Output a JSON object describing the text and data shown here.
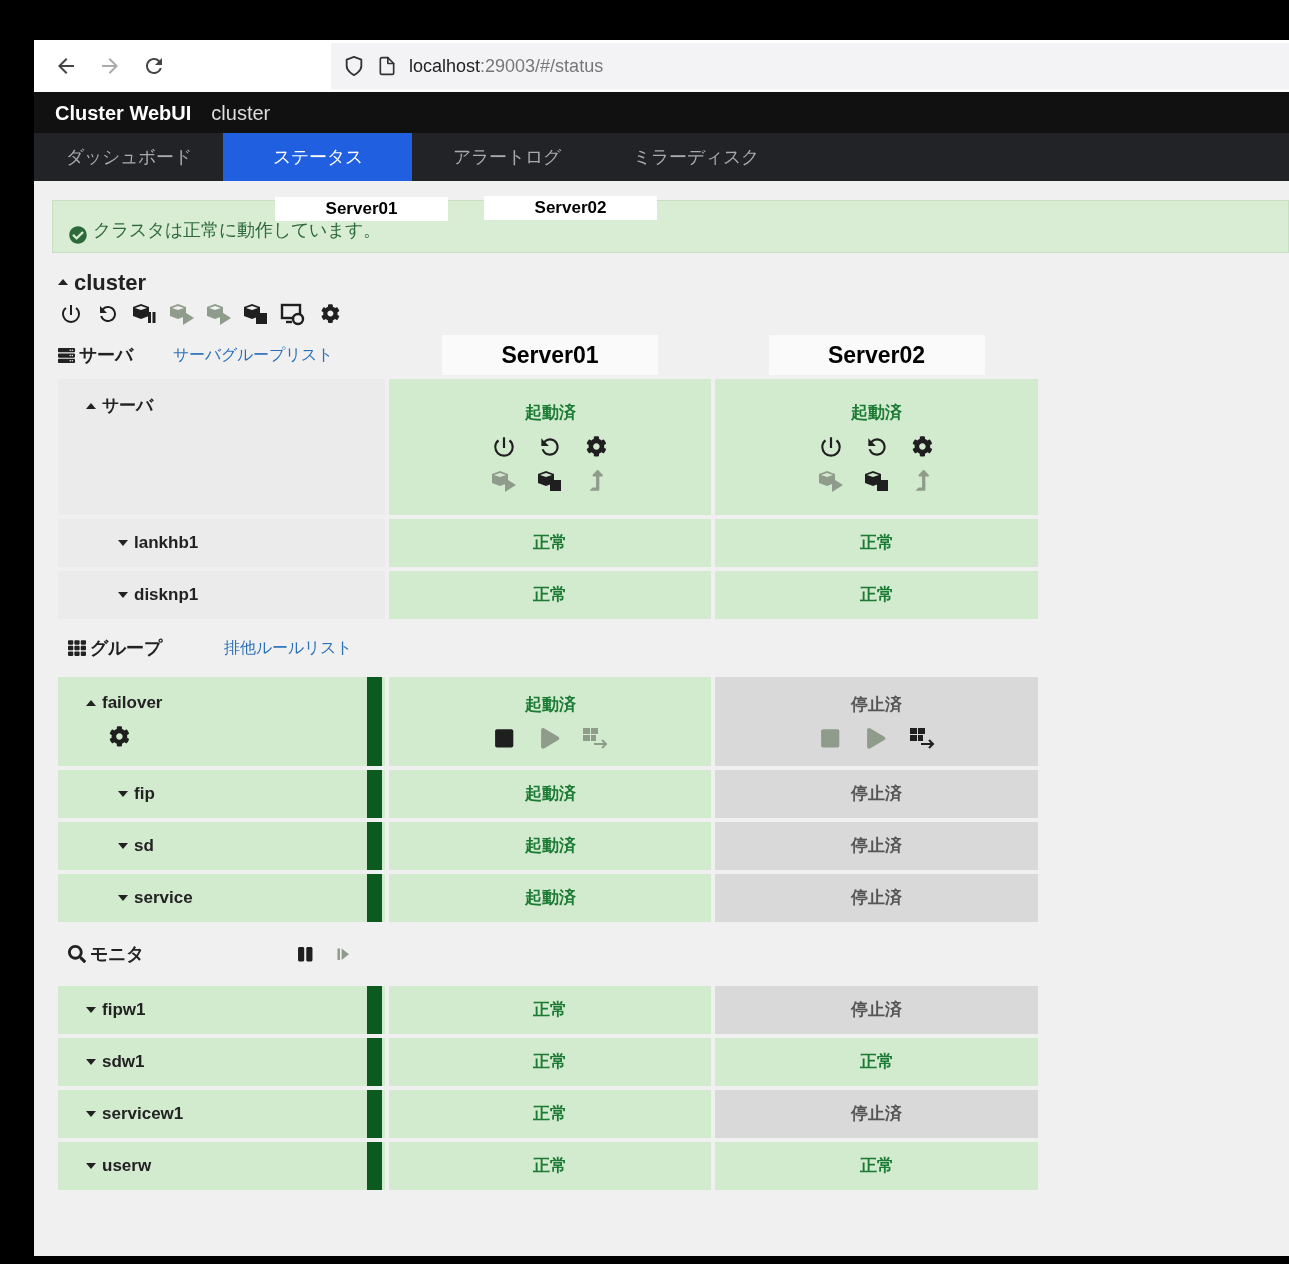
{
  "browser": {
    "url_host": "localhost",
    "url_rest": ":29003/#/status"
  },
  "header": {
    "brand": "Cluster WebUI",
    "cluster_name": "cluster"
  },
  "tabs": [
    {
      "label": "ダッシュボード",
      "selected": false
    },
    {
      "label": "ステータス",
      "selected": true
    },
    {
      "label": "アラートログ",
      "selected": false
    },
    {
      "label": "ミラーディスク",
      "selected": false
    }
  ],
  "overlay_labels": [
    "Server01",
    "Server02"
  ],
  "alert": {
    "text": "クラスタは正常に動作しています。"
  },
  "cluster": {
    "name": "cluster",
    "expanded": true,
    "actions": [
      {
        "kind": "power",
        "disabled": false
      },
      {
        "kind": "restart",
        "disabled": false
      },
      {
        "kind": "cube-pause",
        "disabled": false
      },
      {
        "kind": "cube-resume",
        "disabled": true
      },
      {
        "kind": "cube-play",
        "disabled": true
      },
      {
        "kind": "cube-stop",
        "disabled": false
      },
      {
        "kind": "screen-restore",
        "disabled": false
      },
      {
        "kind": "gear",
        "disabled": false
      }
    ]
  },
  "servers_section": {
    "title": "サーバ",
    "link": "サーバグループリスト",
    "columns": [
      "Server01",
      "Server02"
    ],
    "server_row": {
      "name": "サーバ",
      "expanded": true,
      "cells": [
        {
          "status": "起動済",
          "stopped": false,
          "actions": [
            [
              {
                "kind": "power",
                "disabled": false
              },
              {
                "kind": "restart",
                "disabled": false
              },
              {
                "kind": "gear",
                "disabled": false
              }
            ],
            [
              {
                "kind": "cube-play",
                "disabled": true
              },
              {
                "kind": "cube-stop",
                "disabled": false
              },
              {
                "kind": "arrow-up",
                "disabled": true
              }
            ]
          ]
        },
        {
          "status": "起動済",
          "stopped": false,
          "actions": [
            [
              {
                "kind": "power",
                "disabled": false
              },
              {
                "kind": "restart",
                "disabled": false
              },
              {
                "kind": "gear",
                "disabled": false
              }
            ],
            [
              {
                "kind": "cube-play",
                "disabled": true
              },
              {
                "kind": "cube-stop",
                "disabled": false
              },
              {
                "kind": "arrow-up",
                "disabled": true
              }
            ]
          ]
        }
      ]
    },
    "resources": [
      {
        "name": "lankhb1",
        "expanded": false,
        "cells": [
          {
            "status": "正常",
            "stopped": false
          },
          {
            "status": "正常",
            "stopped": false
          }
        ]
      },
      {
        "name": "disknp1",
        "expanded": false,
        "cells": [
          {
            "status": "正常",
            "stopped": false
          },
          {
            "status": "正常",
            "stopped": false
          }
        ]
      }
    ]
  },
  "groups_section": {
    "title": "グループ",
    "link": "排他ルールリスト",
    "group": {
      "name": "failover",
      "expanded": true,
      "stopped": false,
      "settings": {
        "kind": "gear",
        "disabled": false
      },
      "cells": [
        {
          "status": "起動済",
          "stopped": false,
          "actions": [
            {
              "kind": "stop",
              "disabled": false
            },
            {
              "kind": "play",
              "disabled": true
            },
            {
              "kind": "move",
              "disabled": true
            }
          ]
        },
        {
          "status": "停止済",
          "stopped": true,
          "actions": [
            {
              "kind": "stop",
              "disabled": true
            },
            {
              "kind": "play",
              "disabled": true
            },
            {
              "kind": "move",
              "disabled": false
            }
          ]
        }
      ]
    },
    "resources": [
      {
        "name": "fip",
        "expanded": false,
        "stopped": false,
        "cells": [
          {
            "status": "起動済",
            "stopped": false
          },
          {
            "status": "停止済",
            "stopped": true
          }
        ]
      },
      {
        "name": "sd",
        "expanded": false,
        "stopped": false,
        "cells": [
          {
            "status": "起動済",
            "stopped": false
          },
          {
            "status": "停止済",
            "stopped": true
          }
        ]
      },
      {
        "name": "service",
        "expanded": false,
        "stopped": false,
        "cells": [
          {
            "status": "起動済",
            "stopped": false
          },
          {
            "status": "停止済",
            "stopped": true
          }
        ]
      }
    ]
  },
  "monitors_section": {
    "title": "モニタ",
    "actions": [
      {
        "kind": "pause",
        "disabled": false
      },
      {
        "kind": "resume",
        "disabled": true
      }
    ],
    "monitors": [
      {
        "name": "fipw1",
        "expanded": false,
        "stopped": false,
        "cells": [
          {
            "status": "正常",
            "stopped": false
          },
          {
            "status": "停止済",
            "stopped": true
          }
        ]
      },
      {
        "name": "sdw1",
        "expanded": false,
        "stopped": false,
        "cells": [
          {
            "status": "正常",
            "stopped": false
          },
          {
            "status": "正常",
            "stopped": false
          }
        ]
      },
      {
        "name": "servicew1",
        "expanded": false,
        "stopped": false,
        "cells": [
          {
            "status": "正常",
            "stopped": false
          },
          {
            "status": "停止済",
            "stopped": true
          }
        ]
      },
      {
        "name": "userw",
        "expanded": false,
        "stopped": false,
        "cells": [
          {
            "status": "正常",
            "stopped": false
          },
          {
            "status": "正常",
            "stopped": false
          }
        ]
      }
    ]
  }
}
